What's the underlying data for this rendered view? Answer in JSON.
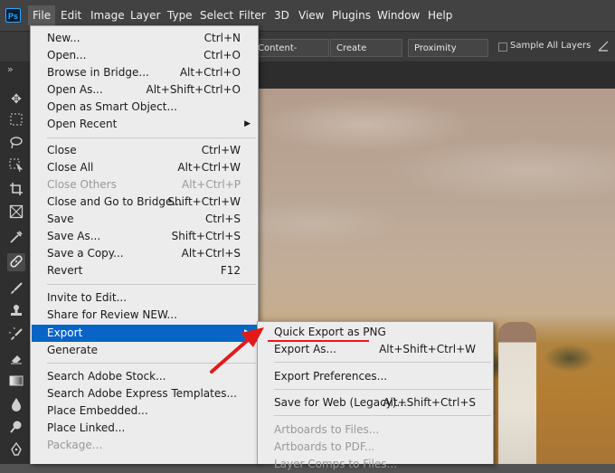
{
  "menubar": {
    "logo": "Ps",
    "items": [
      "File",
      "Edit",
      "Image",
      "Layer",
      "Type",
      "Select",
      "Filter",
      "3D",
      "View",
      "Plugins",
      "Window",
      "Help"
    ]
  },
  "options_bar": {
    "buttons": [
      "Content-Aware",
      "Create Texture",
      "Proximity Match"
    ],
    "checkbox_label": "Sample All Layers",
    "collapse_glyph": "»"
  },
  "file_menu": {
    "items": [
      {
        "label": "New...",
        "shortcut": "Ctrl+N"
      },
      {
        "label": "Open...",
        "shortcut": "Ctrl+O"
      },
      {
        "label": "Browse in Bridge...",
        "shortcut": "Alt+Ctrl+O"
      },
      {
        "label": "Open As...",
        "shortcut": "Alt+Shift+Ctrl+O"
      },
      {
        "label": "Open as Smart Object...",
        "shortcut": ""
      },
      {
        "label": "Open Recent",
        "shortcut": "",
        "submenu": true
      },
      {
        "label": "Close",
        "shortcut": "Ctrl+W"
      },
      {
        "label": "Close All",
        "shortcut": "Alt+Ctrl+W"
      },
      {
        "label": "Close Others",
        "shortcut": "Alt+Ctrl+P",
        "disabled": true
      },
      {
        "label": "Close and Go to Bridge...",
        "shortcut": "Shift+Ctrl+W"
      },
      {
        "label": "Save",
        "shortcut": "Ctrl+S"
      },
      {
        "label": "Save As...",
        "shortcut": "Shift+Ctrl+S"
      },
      {
        "label": "Save a Copy...",
        "shortcut": "Alt+Ctrl+S"
      },
      {
        "label": "Revert",
        "shortcut": "F12"
      },
      {
        "label": "Invite to Edit...",
        "shortcut": ""
      },
      {
        "label": "Share for Review NEW...",
        "shortcut": ""
      },
      {
        "label": "Export",
        "shortcut": "",
        "submenu": true,
        "active": true
      },
      {
        "label": "Generate",
        "shortcut": ""
      },
      {
        "label": "Search Adobe Stock...",
        "shortcut": ""
      },
      {
        "label": "Search Adobe Express Templates...",
        "shortcut": ""
      },
      {
        "label": "Place Embedded...",
        "shortcut": ""
      },
      {
        "label": "Place Linked...",
        "shortcut": ""
      },
      {
        "label": "Package...",
        "shortcut": "",
        "disabled": true
      }
    ]
  },
  "export_submenu": {
    "items": [
      {
        "label": "Quick Export as PNG",
        "shortcut": ""
      },
      {
        "label": "Export As...",
        "shortcut": "Alt+Shift+Ctrl+W"
      },
      {
        "label": "Export Preferences...",
        "shortcut": ""
      },
      {
        "label": "Save for Web (Legacy)...",
        "shortcut": "Alt+Shift+Ctrl+S"
      },
      {
        "label": "Artboards to Files...",
        "shortcut": "",
        "disabled": true
      },
      {
        "label": "Artboards to PDF...",
        "shortcut": "",
        "disabled": true
      },
      {
        "label": "Layer Comps to Files...",
        "shortcut": "",
        "disabled": true
      }
    ]
  },
  "tools": [
    "move-icon",
    "marquee-icon",
    "lasso-icon",
    "object-select-icon",
    "crop-icon",
    "frame-icon",
    "eyedropper-icon",
    "healing-brush-icon",
    "brush-icon",
    "stamp-icon",
    "history-brush-icon",
    "eraser-icon",
    "gradient-icon",
    "blur-icon",
    "dodge-icon",
    "pen-icon"
  ],
  "annotation": {
    "arrow_color": "#e21a1a",
    "underline_color": "#e21a1a"
  }
}
